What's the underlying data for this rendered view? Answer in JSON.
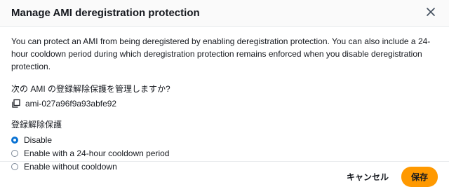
{
  "modal": {
    "title": "Manage AMI deregistration protection",
    "description": "You can protect an AMI from being deregistered by enabling deregistration protection. You can also include a 24-hour cooldown period during which deregistration protection remains enforced when you disable deregistration protection.",
    "question": "次の AMI の登録解除保護を管理しますか?",
    "ami_id": "ami-027a96f9a93abfe92",
    "group_label": "登録解除保護",
    "options": [
      {
        "label": "Disable",
        "selected": true
      },
      {
        "label": "Enable with a 24-hour cooldown period",
        "selected": false
      },
      {
        "label": "Enable without cooldown",
        "selected": false
      }
    ],
    "cancel_label": "キャンセル",
    "save_label": "保存"
  },
  "colors": {
    "accent": "#0972d3",
    "primary_button": "#ff9900"
  },
  "icons": {
    "close": "close-icon",
    "copy": "copy-icon"
  }
}
